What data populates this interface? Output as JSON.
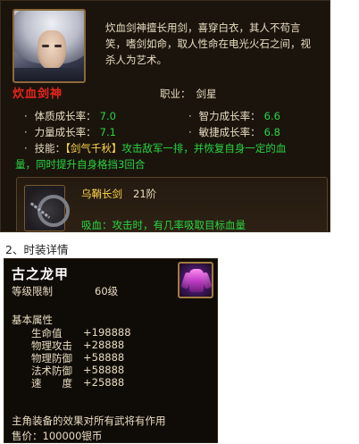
{
  "character": {
    "name": "炊血剑神",
    "description_lines": [
      "炊血剑神擅长用剑，喜穿白衣，其人不苟言",
      "笑，嗜剑如命，取人性命在电光火石之间，视",
      "杀人为艺术。"
    ],
    "job_label": "职业：",
    "job_value": "剑星",
    "bullet": "·",
    "stats": [
      {
        "label": "体质成长率：",
        "value": "7.0"
      },
      {
        "label": "智力成长率：",
        "value": "6.6"
      },
      {
        "label": "力量成长率：",
        "value": "7.1"
      },
      {
        "label": "敏捷成长率：",
        "value": "6.8"
      }
    ],
    "skill": {
      "label": "技能：",
      "name": "【剑气千秋】",
      "effect_line1": "攻击敌军一排，并恢复自身一定的血",
      "effect_line2": "量，同时提升自身格挡3回合"
    },
    "weapon": {
      "name": "乌鞘长剑",
      "level": "21阶",
      "effect": "吸血：攻击时，有几率吸取目标血量"
    }
  },
  "section": {
    "heading": "2、时装详情"
  },
  "costume": {
    "title": "古之龙甲",
    "level_label": "等级限制",
    "level_value": "60级",
    "attr_heading": "基本属性",
    "attributes": [
      {
        "label": "生命值",
        "value": "+198888"
      },
      {
        "label": "物理攻击",
        "value": "+28888"
      },
      {
        "label": "物理防御",
        "value": "+58888"
      },
      {
        "label": "法术防御",
        "value": "+58888"
      },
      {
        "label": "速　　度",
        "value": "+25888"
      }
    ],
    "note": "主角装备的效果对所有武将有作用",
    "price": "售价：100000银币"
  },
  "colors": {
    "name_red": "#e8251b",
    "value_green": "#27d640",
    "highlight_gold": "#ffd84a",
    "panel_bg": "#1b140d",
    "text_beige": "#e8dcc0"
  },
  "icons": {
    "portrait": "character-portrait",
    "weapon": "chain-sword-icon",
    "costume": "dragon-armor-icon"
  }
}
